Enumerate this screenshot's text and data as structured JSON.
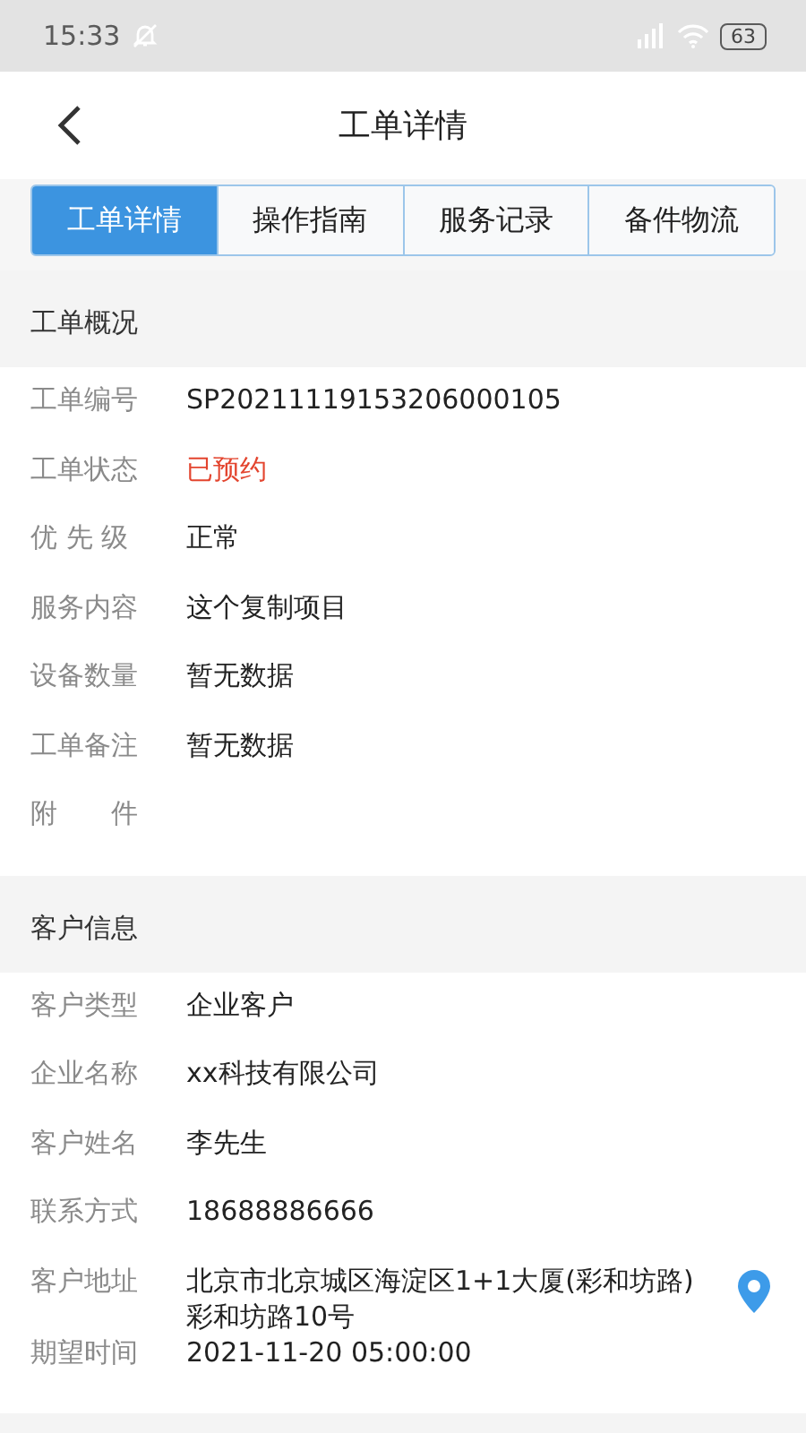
{
  "status_bar": {
    "time": "15:33",
    "battery": "63"
  },
  "header": {
    "title": "工单详情"
  },
  "tabs": [
    {
      "label": "工单详情",
      "selected": true
    },
    {
      "label": "操作指南",
      "selected": false
    },
    {
      "label": "服务记录",
      "selected": false
    },
    {
      "label": "备件物流",
      "selected": false
    }
  ],
  "sections": [
    {
      "title": "工单概况",
      "rows": [
        {
          "kind": "text",
          "label": "工单编号",
          "value": "SP20211119153206000105"
        },
        {
          "kind": "status",
          "label": "工单状态",
          "value": "已预约"
        },
        {
          "kind": "text",
          "label": "优 先 级",
          "value": "正常"
        },
        {
          "kind": "text",
          "label": "服务内容",
          "value": "这个复制项目"
        },
        {
          "kind": "text",
          "label": "设备数量",
          "value": "暂无数据"
        },
        {
          "kind": "text",
          "label": "工单备注",
          "value": "暂无数据"
        },
        {
          "kind": "empty",
          "label": "附　　件"
        }
      ]
    },
    {
      "title": "客户信息",
      "rows": [
        {
          "kind": "text",
          "label": "客户类型",
          "value": "企业客户"
        },
        {
          "kind": "text",
          "label": "企业名称",
          "value": "xx科技有限公司"
        },
        {
          "kind": "text",
          "label": "客户姓名",
          "value": "李先生"
        },
        {
          "kind": "text",
          "label": "联系方式",
          "value": "18688886666"
        },
        {
          "kind": "address",
          "label": "客户地址",
          "value": "北京市北京城区海淀区1+1大厦(彩和坊路)彩和坊路10号"
        },
        {
          "kind": "text",
          "label": "期望时间",
          "value": "2021-11-20 05:00:00"
        }
      ]
    }
  ]
}
